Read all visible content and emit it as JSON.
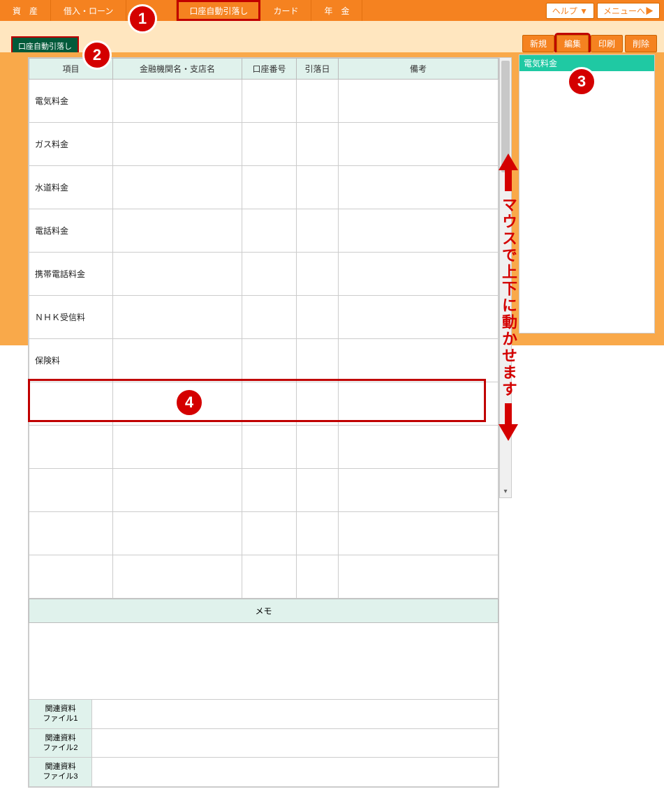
{
  "topnav": {
    "tabs": [
      "資　産",
      "借入・ローン",
      "",
      "口座自動引落し",
      "カード",
      "年　金"
    ],
    "help": "ヘルプ ▼",
    "menu": "メニューへ▶"
  },
  "subhead": {
    "subtab": "口座自動引落し",
    "toolbar": {
      "new": "新規",
      "edit": "編集",
      "print": "印刷",
      "delete": "削除"
    }
  },
  "table": {
    "headers": {
      "item": "項目",
      "institution": "金融機関名・支店名",
      "account": "口座番号",
      "date": "引落日",
      "note": "備考"
    },
    "rows": [
      {
        "item": "電気料金",
        "institution": "",
        "account": "",
        "date": "",
        "note": ""
      },
      {
        "item": "ガス料金",
        "institution": "",
        "account": "",
        "date": "",
        "note": ""
      },
      {
        "item": "水道料金",
        "institution": "",
        "account": "",
        "date": "",
        "note": ""
      },
      {
        "item": "電話料金",
        "institution": "",
        "account": "",
        "date": "",
        "note": ""
      },
      {
        "item": "携帯電話料金",
        "institution": "",
        "account": "",
        "date": "",
        "note": ""
      },
      {
        "item": "ＮＨＫ受信料",
        "institution": "",
        "account": "",
        "date": "",
        "note": ""
      },
      {
        "item": "保険料",
        "institution": "",
        "account": "",
        "date": "",
        "note": ""
      },
      {
        "item": "",
        "institution": "",
        "account": "",
        "date": "",
        "note": ""
      },
      {
        "item": "",
        "institution": "",
        "account": "",
        "date": "",
        "note": ""
      },
      {
        "item": "",
        "institution": "",
        "account": "",
        "date": "",
        "note": ""
      },
      {
        "item": "",
        "institution": "",
        "account": "",
        "date": "",
        "note": ""
      },
      {
        "item": "",
        "institution": "",
        "account": "",
        "date": "",
        "note": ""
      }
    ],
    "memo_label": "メモ",
    "files": {
      "f1": "関連資料\nファイル1",
      "f2": "関連資料\nファイル2",
      "f3": "関連資料\nファイル3"
    }
  },
  "sidepanel": {
    "selected": "電気料金"
  },
  "annotations": {
    "badge1": "1",
    "badge2": "2",
    "badge3": "3",
    "badge4": "4",
    "scroll_hint": "マウスで上下に動かせます"
  }
}
